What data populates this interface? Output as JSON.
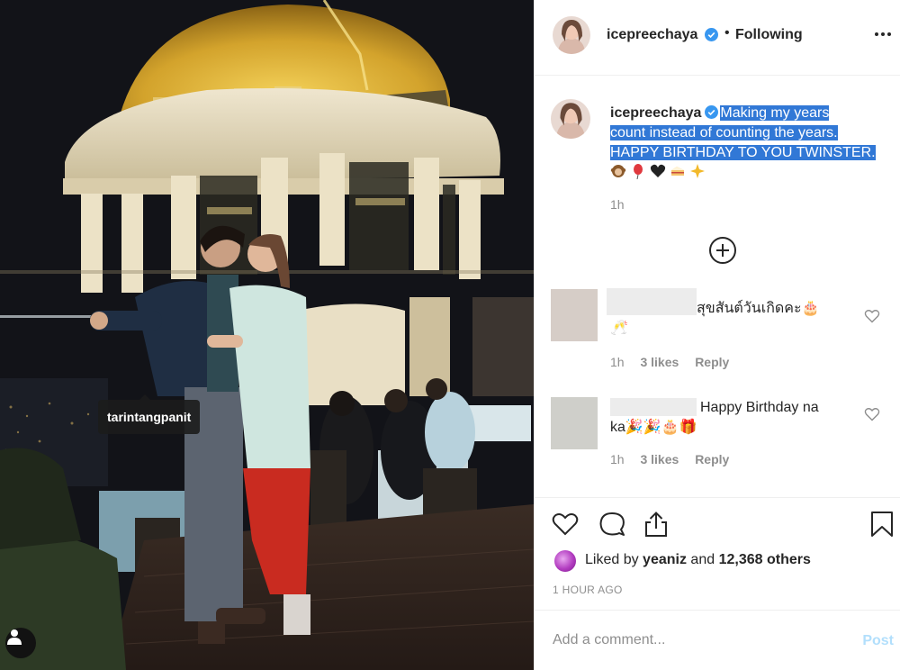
{
  "photo": {
    "tag_user": "tarintangpanit",
    "user_tag_icon": "user-icon"
  },
  "header": {
    "username": "icepreechaya",
    "separator": "•",
    "follow_label": "Following",
    "more_icon": "more-horizontal-icon"
  },
  "caption": {
    "username": "icepreechaya",
    "text_line1": "Making my years",
    "text_line2": "count instead of counting the years.",
    "text_line3": "HAPPY BIRTHDAY TO YOU TWINSTER.",
    "emojis": [
      "monkey-emoji",
      "balloon-emoji",
      "black-heart-emoji",
      "cake-slice-emoji",
      "sparkle-emoji"
    ],
    "time": "1h"
  },
  "load_more_icon": "plus-circle-icon",
  "comments": [
    {
      "text": "สุขสันต์วันเกิดคะ🎂",
      "text2": "🥂",
      "time": "1h",
      "likes": "3 likes",
      "reply": "Reply"
    },
    {
      "text": "Happy Birthday na",
      "text2": "ka🎉🎉🎂🎁",
      "time": "1h",
      "likes": "3 likes",
      "reply": "Reply"
    }
  ],
  "actions": {
    "like_icon": "heart-icon",
    "comment_icon": "comment-icon",
    "share_icon": "share-icon",
    "save_icon": "bookmark-icon"
  },
  "likes": {
    "prefix": "Liked by",
    "user": "yeaniz",
    "joiner": "and",
    "count": "12,368 others"
  },
  "posted_time": "1 HOUR AGO",
  "add_comment": {
    "placeholder": "Add a comment...",
    "post_label": "Post"
  },
  "colors": {
    "highlight": "#3178d6",
    "verified": "#3897f0",
    "post_disabled": "#b2dffc",
    "muted": "#8e8e8e"
  }
}
